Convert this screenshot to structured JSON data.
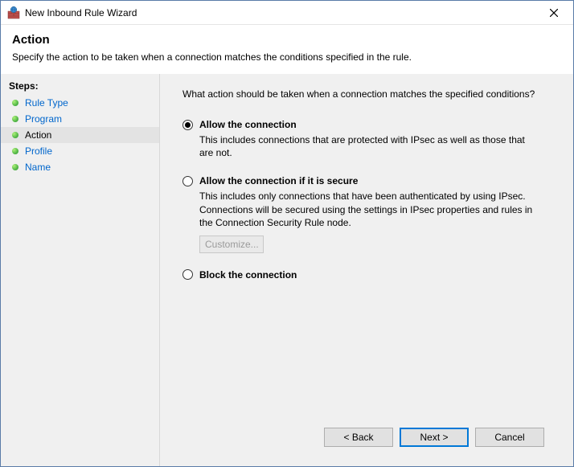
{
  "titlebar": {
    "title": "New Inbound Rule Wizard"
  },
  "header": {
    "title": "Action",
    "subtitle": "Specify the action to be taken when a connection matches the conditions specified in the rule."
  },
  "sidebar": {
    "heading": "Steps:",
    "items": [
      {
        "label": "Rule Type",
        "current": false
      },
      {
        "label": "Program",
        "current": false
      },
      {
        "label": "Action",
        "current": true
      },
      {
        "label": "Profile",
        "current": false
      },
      {
        "label": "Name",
        "current": false
      }
    ]
  },
  "main": {
    "prompt": "What action should be taken when a connection matches the specified conditions?",
    "options": [
      {
        "label": "Allow the connection",
        "description": "This includes connections that are protected with IPsec as well as those that are not.",
        "selected": true
      },
      {
        "label": "Allow the connection if it is secure",
        "description": "This includes only connections that have been authenticated by using IPsec.  Connections will be secured using the settings in IPsec properties and rules in the Connection Security Rule node.",
        "selected": false,
        "customize_label": "Customize..."
      },
      {
        "label": "Block the connection",
        "selected": false
      }
    ]
  },
  "footer": {
    "back": "< Back",
    "next": "Next >",
    "cancel": "Cancel"
  }
}
